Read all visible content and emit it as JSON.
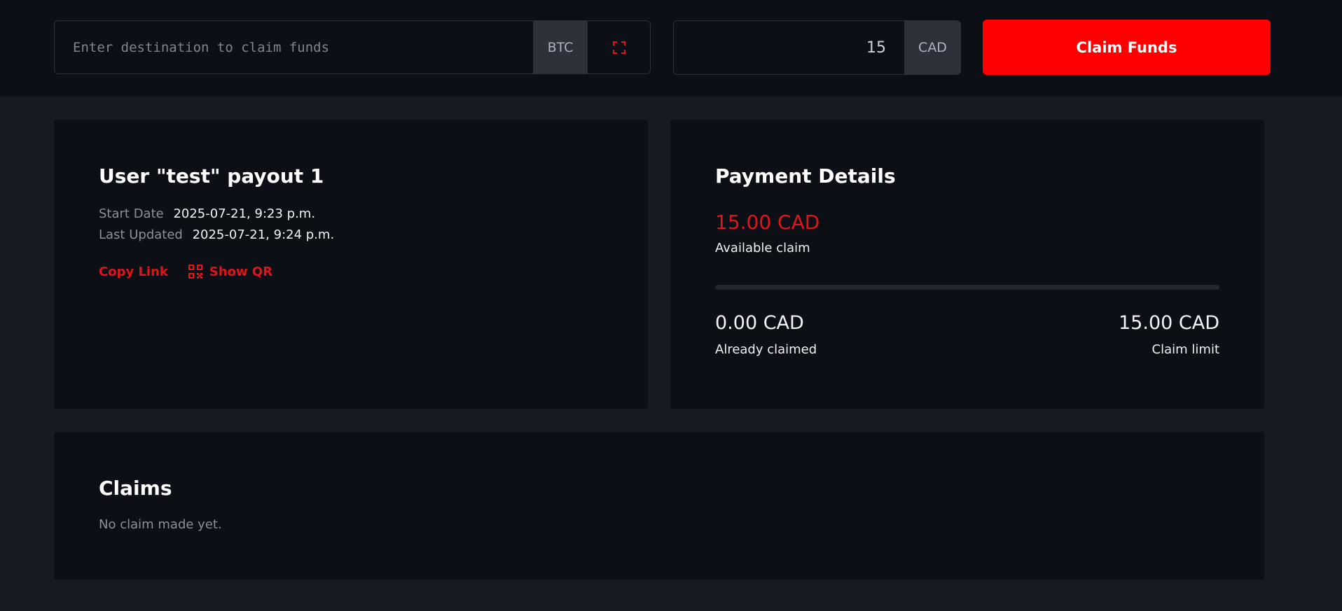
{
  "claim_bar": {
    "destination_placeholder": "Enter destination to claim funds",
    "destination_value": "",
    "destination_currency": "BTC",
    "scan_icon": "qr-scan-icon",
    "amount_value": "15",
    "amount_currency": "CAD",
    "claim_button_label": "Claim Funds"
  },
  "payout": {
    "title": "User \"test\" payout 1",
    "start_date_label": "Start Date",
    "start_date_value": "2025-07-21, 9:23 p.m.",
    "last_updated_label": "Last Updated",
    "last_updated_value": "2025-07-21, 9:24 p.m.",
    "copy_link_label": "Copy Link",
    "show_qr_label": "Show QR"
  },
  "payment": {
    "title": "Payment Details",
    "available_amount": "15.00 CAD",
    "available_label": "Available claim",
    "progress_fraction": 0,
    "claimed_amount": "0.00 CAD",
    "claimed_label": "Already claimed",
    "limit_amount": "15.00 CAD",
    "limit_label": "Claim limit"
  },
  "claims": {
    "title": "Claims",
    "empty_message": "No claim made yet."
  },
  "colors": {
    "accent": "#ff0000",
    "link": "#e0151a",
    "background": "#161a21",
    "surface": "#0c0f15"
  }
}
